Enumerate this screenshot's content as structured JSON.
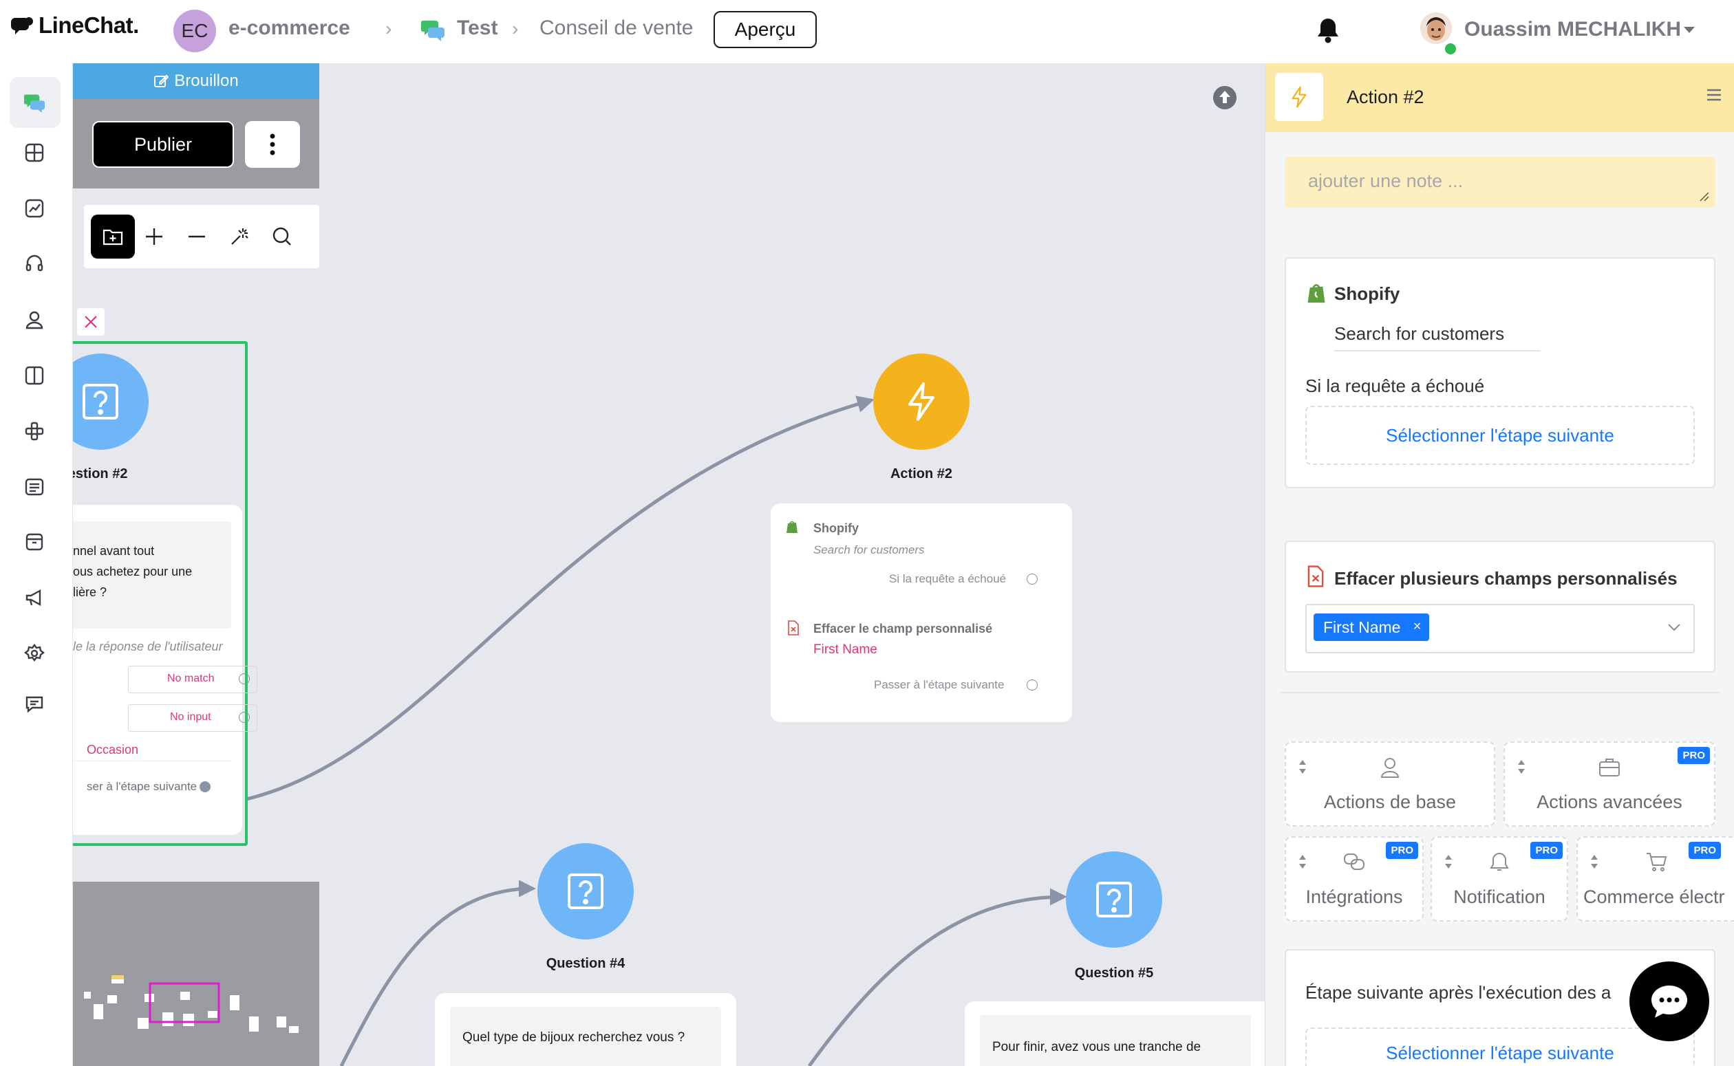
{
  "topbar": {
    "logo_text": "LineChat.",
    "workspace_initials": "EC",
    "workspace_name": "e-commerce",
    "bot_name": "Test",
    "flow_name": "Conseil de vente",
    "preview_label": "Aperçu",
    "username": "Ouassim MECHALIKH"
  },
  "toolbar": {
    "draft_label": "Brouillon",
    "publish_label": "Publier"
  },
  "canvas": {
    "nodes": {
      "question2": {
        "title": "uestion #2",
        "message": "nnel avant tout\nous achetez pour une\nlière ?",
        "response_hint": "le la réponse de l'utilisateur",
        "no_match": "No match",
        "no_input": "No input",
        "occasion": "Occasion",
        "next_step": "ser à l'étape suivante"
      },
      "action2": {
        "title": "Action #2",
        "shopify_label": "Shopify",
        "shopify_action": "Search for customers",
        "fail_label": "Si la requête a échoué",
        "clear_label": "Effacer le champ personnalisé",
        "field": "First Name",
        "next_label": "Passer à l'étape suivante"
      },
      "question4": {
        "title": "Question #4",
        "message": "Quel type de bijoux recherchez vous ?"
      },
      "question5": {
        "title": "Question #5",
        "message": "Pour finir, avez vous une tranche de"
      }
    }
  },
  "panel": {
    "title": "Action #2",
    "note_placeholder": "ajouter une note ...",
    "shopify": {
      "label": "Shopify",
      "action": "Search for customers",
      "fail_label": "Si la requête a échoué",
      "select_next": "Sélectionner l'étape suivante"
    },
    "clear_fields": {
      "label": "Effacer plusieurs champs personnalisés",
      "chip": "First Name",
      "chip_remove": "×"
    },
    "categories": [
      {
        "label": "Actions de base",
        "pro": false
      },
      {
        "label": "Actions avancées",
        "pro": true
      },
      {
        "label": "Intégrations",
        "pro": true
      },
      {
        "label": "Notification",
        "pro": true
      },
      {
        "label": "Commerce électr",
        "pro": true
      }
    ],
    "pro_badge": "PRO",
    "after_exec_label": "Étape suivante après l'exécution des a",
    "select_next_bottom": "Sélectionner l'étape suivante"
  },
  "colors": {
    "accent_blue": "#1677ff",
    "node_blue": "#6eb6f8",
    "node_yellow": "#f4b31c",
    "selection_green": "#28c26a",
    "link_pink": "#e0357a",
    "header_yellow": "#fde9a6"
  }
}
